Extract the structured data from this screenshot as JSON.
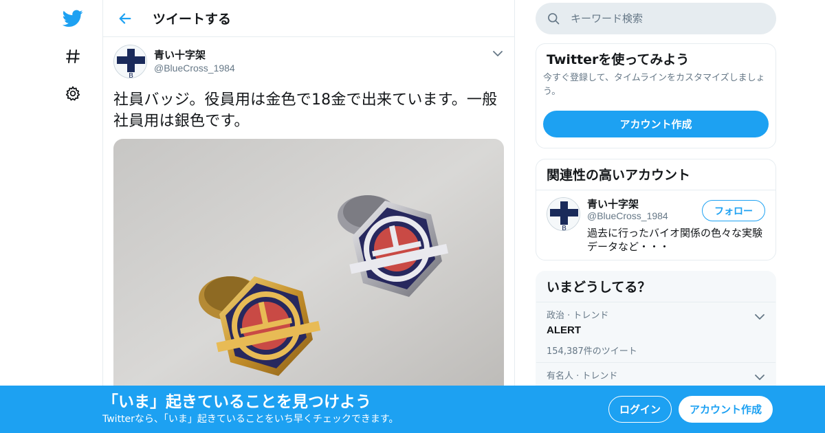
{
  "nav": {
    "icons": [
      "twitter-bird-icon",
      "hashtag-icon",
      "gear-icon"
    ]
  },
  "header": {
    "title": "ツイートする"
  },
  "tweet": {
    "author_name": "青い十字架",
    "author_handle": "@BlueCross_1984",
    "text": "社員バッジ。役員用は金色で18金で出来ています。一般社員用は銀色です。"
  },
  "search": {
    "placeholder": "キーワード検索"
  },
  "signup_card": {
    "title": "Twitterを使ってみよう",
    "description": "今すぐ登録して、タイムラインをカスタマイズしましょう。",
    "button": "アカウント作成"
  },
  "related_card": {
    "title": "関連性の高いアカウント",
    "user": {
      "name": "青い十字架",
      "handle": "@BlueCross_1984",
      "bio": "過去に行ったバイオ関係の色々な実験データなど・・・",
      "follow_label": "フォロー"
    }
  },
  "trends_card": {
    "title": "いまどうしてる？",
    "trends": [
      {
        "meta": "政治 · トレンド",
        "name": "ALERT",
        "count": "154,387件のツイート"
      },
      {
        "meta": "有名人 · トレンド",
        "name": "",
        "count": ""
      }
    ]
  },
  "banner": {
    "title": "「いま」起きていることを見つけよう",
    "subtitle": "Twitterなら、「いま」起きていることをいち早くチェックできます。",
    "login_label": "ログイン",
    "signup_label": "アカウント作成"
  },
  "colors": {
    "accent": "#1da1f2",
    "badge_navy": "#27285e",
    "badge_red": "#c94a45",
    "gold": "#d9a640",
    "silver": "#c9c9cf"
  }
}
